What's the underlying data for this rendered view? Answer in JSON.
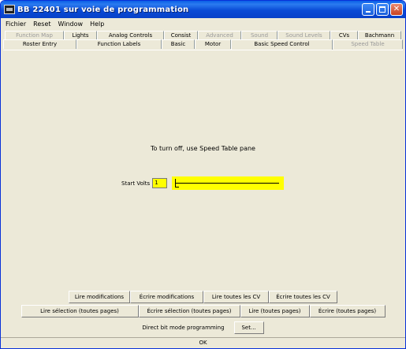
{
  "window": {
    "title": "BB 22401 sur voie de programmation"
  },
  "menu": [
    "Fichier",
    "Reset",
    "Window",
    "Help"
  ],
  "tabs": {
    "back_row": [
      {
        "label": "Function Map",
        "enabled": false
      },
      {
        "label": "Lights",
        "enabled": true
      },
      {
        "label": "Analog Controls",
        "enabled": true
      },
      {
        "label": "Consist",
        "enabled": true
      },
      {
        "label": "Advanced",
        "enabled": false
      },
      {
        "label": "Sound",
        "enabled": false
      },
      {
        "label": "Sound Levels",
        "enabled": false
      },
      {
        "label": "CVs",
        "enabled": true
      },
      {
        "label": "Bachmann",
        "enabled": true
      }
    ],
    "front_row": [
      {
        "label": "Roster Entry",
        "enabled": true
      },
      {
        "label": "Function Labels",
        "enabled": true
      },
      {
        "label": "Basic",
        "enabled": true
      },
      {
        "label": "Motor",
        "enabled": true
      },
      {
        "label": "Basic Speed Control",
        "enabled": true,
        "selected": true
      },
      {
        "label": "Speed Table",
        "enabled": false
      }
    ]
  },
  "panel": {
    "hint": "To turn off, use Speed Table pane",
    "start_volts_label": "Start Volts",
    "start_volts_value": "1",
    "highlight_color": "#ffff00"
  },
  "buttons_row1": [
    "Lire modifications",
    "Écrire modifications",
    "Lire toutes les CV",
    "Écrire toutes les CV"
  ],
  "buttons_row2": [
    "Lire sélection (toutes pages)",
    "Écrire sélection (toutes pages)",
    "Lire (toutes pages)",
    "Écrire (toutes pages)"
  ],
  "direct_bit": {
    "label": "Direct bit mode programming",
    "button": "Set..."
  },
  "status": "OK"
}
